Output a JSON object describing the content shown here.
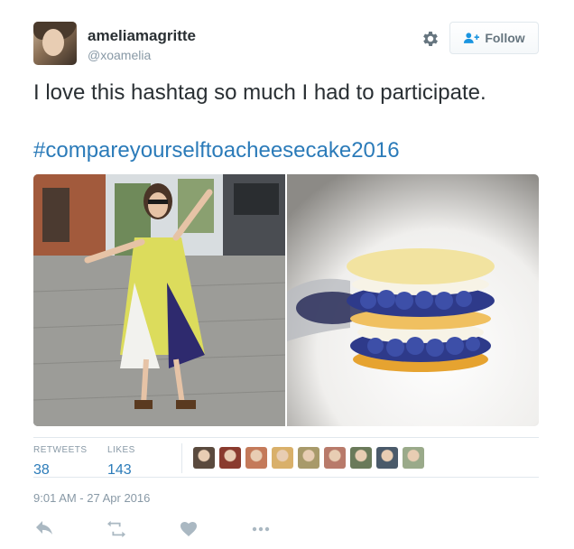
{
  "user": {
    "fullname": "ameliamagritte",
    "username": "@xoamelia"
  },
  "header": {
    "follow_label": "Follow",
    "icons": [
      "gear-icon",
      "follow-person-icon"
    ]
  },
  "tweet": {
    "text": "I love this hashtag so much I had to participate.",
    "hashtag": "#compareyourselftoacheesecake2016"
  },
  "media": {
    "images": [
      "person-photo",
      "cheesecake-photo"
    ]
  },
  "stats": {
    "retweets_label": "RETWEETS",
    "retweets_count": "38",
    "likes_label": "LIKES",
    "likes_count": "143",
    "liker_colors": [
      "#5a4a3e",
      "#8a3b2e",
      "#c47a5a",
      "#d9b06a",
      "#a89a6a",
      "#b87a6a",
      "#6a7a5a",
      "#4a5a6a",
      "#9aaa8a"
    ]
  },
  "timestamp": "9:01 AM - 27 Apr 2016",
  "actions": {
    "icons": [
      "reply-icon",
      "retweet-icon",
      "like-icon",
      "more-icon"
    ]
  },
  "colors": {
    "link": "#2b7bb9",
    "muted": "#8899a6",
    "text": "#292f33"
  }
}
